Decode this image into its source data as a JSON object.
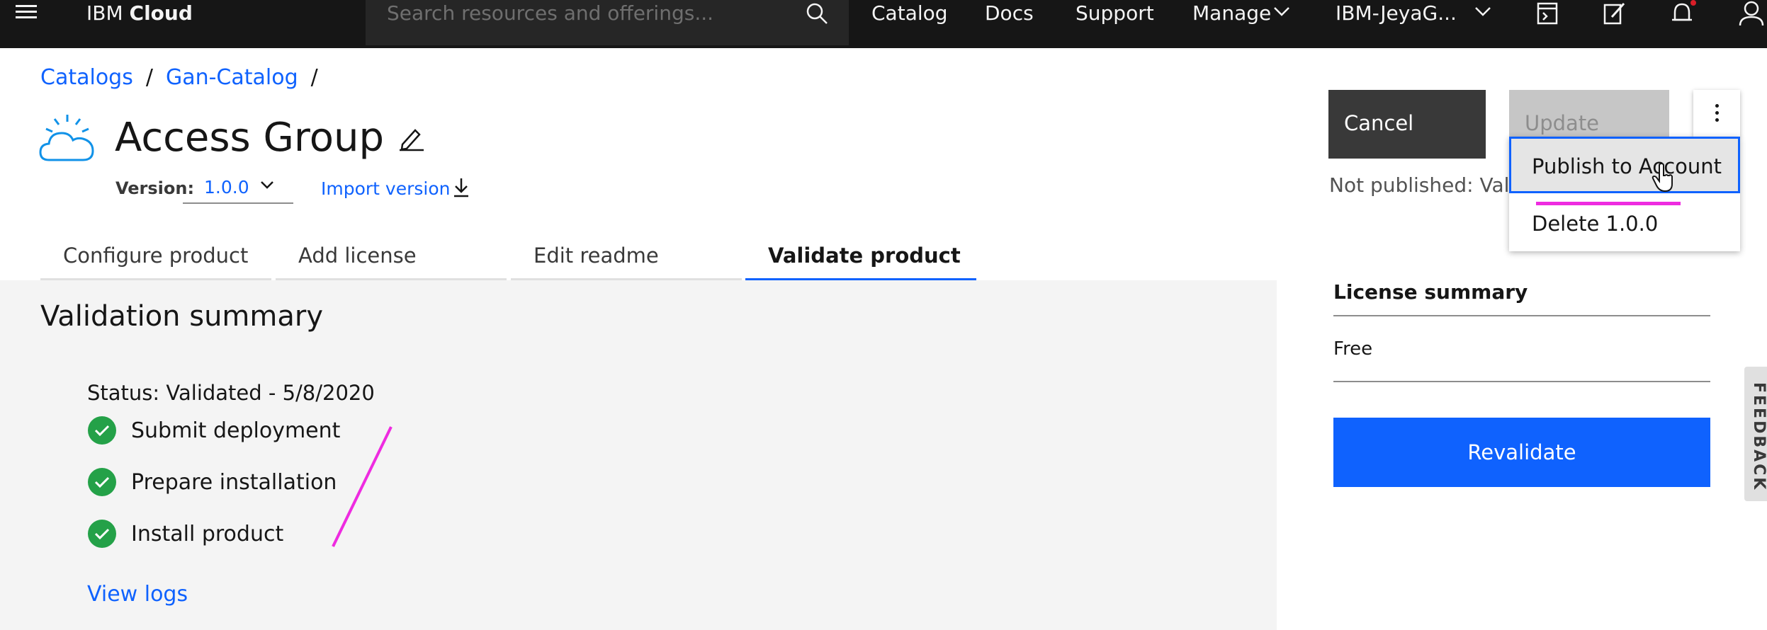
{
  "topbar": {
    "brand_light": "IBM ",
    "brand_bold": "Cloud",
    "search_placeholder": "Search resources and offerings...",
    "nav": {
      "catalog": "Catalog",
      "docs": "Docs",
      "support": "Support",
      "manage": "Manage",
      "account": "IBM-JeyaG..."
    },
    "icons": [
      "menu-icon",
      "search-icon",
      "chevron-down-icon",
      "terminal-icon",
      "edit-icon",
      "notification-icon",
      "user-icon"
    ]
  },
  "breadcrumb": {
    "items": [
      "Catalogs",
      "Gan-Catalog"
    ],
    "separator": "/"
  },
  "header": {
    "title": "Access Group",
    "version_label": "Version:",
    "version_value": "1.0.0",
    "import_label": "Import version"
  },
  "tabs": [
    {
      "label": "Configure product",
      "active": false
    },
    {
      "label": "Add license",
      "active": false
    },
    {
      "label": "Edit readme",
      "active": false
    },
    {
      "label": "Validate product",
      "active": true
    }
  ],
  "validation": {
    "title": "Validation summary",
    "status": "Status: Validated - 5/8/2020",
    "steps": [
      "Submit deployment",
      "Prepare installation",
      "Install product"
    ],
    "view_logs": "View logs"
  },
  "actions": {
    "cancel": "Cancel",
    "update": "Update",
    "not_published": "Not published: Valid"
  },
  "overflow_menu": {
    "items": [
      "Publish to Account",
      "Delete 1.0.0"
    ]
  },
  "license": {
    "title": "License summary",
    "value": "Free",
    "revalidate": "Revalidate"
  },
  "feedback": "FEEDBACK",
  "colors": {
    "accent": "#0f62fe",
    "topbar": "#161616",
    "success": "#24a148",
    "annotation": "#ee2be0"
  }
}
